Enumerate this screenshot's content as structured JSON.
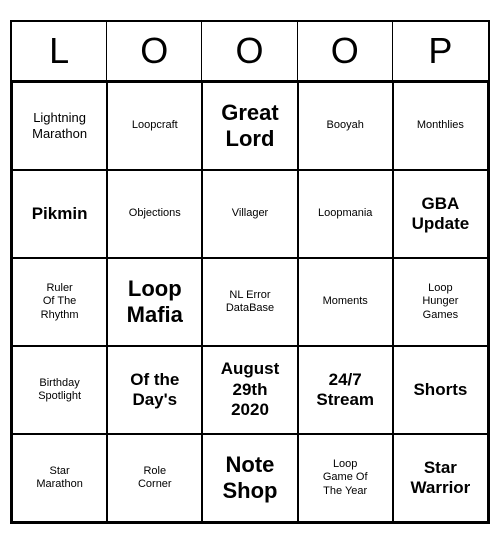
{
  "header": [
    "L",
    "O",
    "O",
    "P"
  ],
  "header_last": "P",
  "cells": [
    {
      "text": "Lightning\nMarathon",
      "size": "normal"
    },
    {
      "text": "Loopcraft",
      "size": "small"
    },
    {
      "text": "Great\nLord",
      "size": "large"
    },
    {
      "text": "Booyah",
      "size": "small"
    },
    {
      "text": "Monthlies",
      "size": "small"
    },
    {
      "text": "Pikmin",
      "size": "medium"
    },
    {
      "text": "Objections",
      "size": "small"
    },
    {
      "text": "Villager",
      "size": "small"
    },
    {
      "text": "Loopmania",
      "size": "small"
    },
    {
      "text": "GBA\nUpdate",
      "size": "medium"
    },
    {
      "text": "Ruler\nOf The\nRhythm",
      "size": "small"
    },
    {
      "text": "Loop\nMafia",
      "size": "large"
    },
    {
      "text": "NL Error\nDataBase",
      "size": "small"
    },
    {
      "text": "Moments",
      "size": "small"
    },
    {
      "text": "Loop\nHunger\nGames",
      "size": "small"
    },
    {
      "text": "Birthday\nSpotlight",
      "size": "small"
    },
    {
      "text": "Of the\nDay's",
      "size": "medium"
    },
    {
      "text": "August\n29th\n2020",
      "size": "medium"
    },
    {
      "text": "24/7\nStream",
      "size": "medium"
    },
    {
      "text": "Shorts",
      "size": "medium"
    },
    {
      "text": "Star\nMarathon",
      "size": "small"
    },
    {
      "text": "Role\nCorner",
      "size": "small"
    },
    {
      "text": "Note\nShop",
      "size": "large"
    },
    {
      "text": "Loop\nGame Of\nThe Year",
      "size": "small"
    },
    {
      "text": "Star\nWarrior",
      "size": "medium"
    }
  ]
}
